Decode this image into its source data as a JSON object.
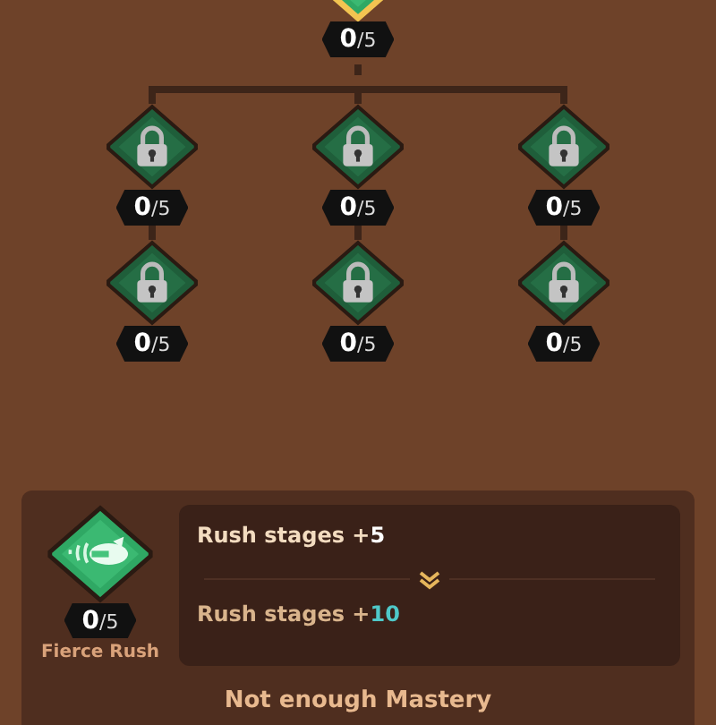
{
  "top_node": {
    "count": "0",
    "total": "/5",
    "selected": true,
    "locked": false
  },
  "branches": [
    {
      "nodes": [
        {
          "count": "0",
          "total": "/5",
          "locked": true
        },
        {
          "count": "0",
          "total": "/5",
          "locked": true
        }
      ]
    },
    {
      "nodes": [
        {
          "count": "0",
          "total": "/5",
          "locked": true
        },
        {
          "count": "0",
          "total": "/5",
          "locked": true
        }
      ]
    },
    {
      "nodes": [
        {
          "count": "0",
          "total": "/5",
          "locked": true
        },
        {
          "count": "0",
          "total": "/5",
          "locked": true
        }
      ]
    }
  ],
  "detail": {
    "skill": {
      "count": "0",
      "total": "/5",
      "name": "Fierce Rush",
      "locked": false
    },
    "lines": [
      {
        "kind": "current",
        "text": "Rush stages +**5**"
      },
      {
        "kind": "next",
        "text": "Rush stages +**10**"
      }
    ],
    "status": "Not enough Mastery"
  }
}
